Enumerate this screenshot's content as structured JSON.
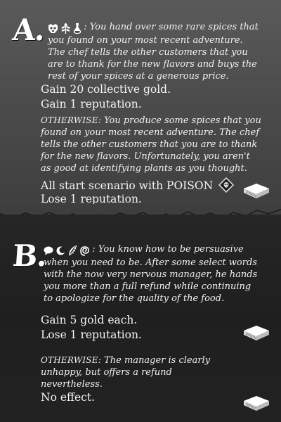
{
  "option_a": {
    "letter": "A.",
    "intro": ": You hand over some rare spices that you found on your most recent adventure. The chef tells the other customers that you are to thank for the new flavors and buys the rest of your spices at a generous price.",
    "effects": [
      "Gain 20 collective gold.",
      "Gain 1 reputation."
    ],
    "otherwise_label": "OTHERWISE:",
    "otherwise_text": " You produce some spices that you found on your most recent adventure. The chef tells the other customers that you are to  thank for the new flavors. Unfortunately, you aren't as good at identifying plants as you thought.",
    "otherwise_effects": [
      "All start scenario with POISON",
      "Lose 1 reputation."
    ],
    "requirement_icons": [
      "skull-mask-icon",
      "herb-sprig-icon",
      "potion-flask-icon"
    ],
    "condition_icon": "poison-icon"
  },
  "option_b": {
    "letter": "B.",
    "intro": ": You know how to be persuasive when you need to be. After some select words with the now very nervous manager, he hands you more than a full refund while continuing to apologize for the quality of the food.",
    "effects": [
      "Gain 5 gold each.",
      "Lose 1 reputation."
    ],
    "otherwise_label": "OTHERWISE:",
    "otherwise_text": " The manager is clearly unhappy, but offers a refund nevertheless.",
    "otherwise_effects": [
      "No effect."
    ],
    "requirement_icons": [
      "speech-bubble-icon",
      "crescent-moon-icon",
      "feather-icon",
      "spiral-icon"
    ]
  },
  "colors": {
    "section_a_bg": "#4c4c4c",
    "section_b_bg": "#222222",
    "text": "#f0f0f0"
  }
}
